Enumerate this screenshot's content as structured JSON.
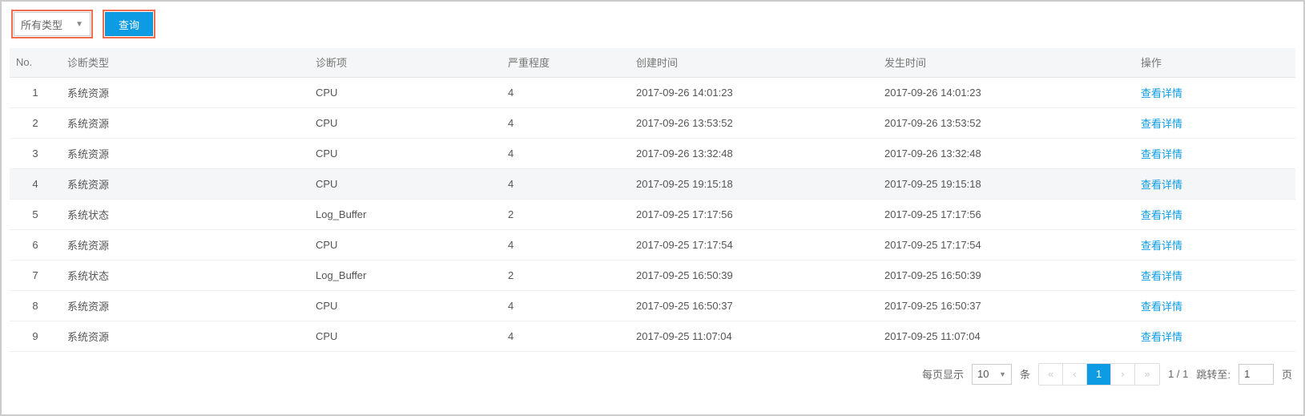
{
  "toolbar": {
    "filter_label": "所有类型",
    "query_label": "查询"
  },
  "table": {
    "headers": {
      "no": "No.",
      "type": "诊断类型",
      "item": "诊断项",
      "severity": "严重程度",
      "created": "创建时间",
      "occurred": "发生时间",
      "action": "操作"
    },
    "action_label": "查看详情",
    "rows": [
      {
        "no": "1",
        "type": "系统资源",
        "item": "CPU",
        "severity": "4",
        "created": "2017-09-26 14:01:23",
        "occurred": "2017-09-26 14:01:23",
        "highlight": false
      },
      {
        "no": "2",
        "type": "系统资源",
        "item": "CPU",
        "severity": "4",
        "created": "2017-09-26 13:53:52",
        "occurred": "2017-09-26 13:53:52",
        "highlight": false
      },
      {
        "no": "3",
        "type": "系统资源",
        "item": "CPU",
        "severity": "4",
        "created": "2017-09-26 13:32:48",
        "occurred": "2017-09-26 13:32:48",
        "highlight": false
      },
      {
        "no": "4",
        "type": "系统资源",
        "item": "CPU",
        "severity": "4",
        "created": "2017-09-25 19:15:18",
        "occurred": "2017-09-25 19:15:18",
        "highlight": true
      },
      {
        "no": "5",
        "type": "系统状态",
        "item": "Log_Buffer",
        "severity": "2",
        "created": "2017-09-25 17:17:56",
        "occurred": "2017-09-25 17:17:56",
        "highlight": false
      },
      {
        "no": "6",
        "type": "系统资源",
        "item": "CPU",
        "severity": "4",
        "created": "2017-09-25 17:17:54",
        "occurred": "2017-09-25 17:17:54",
        "highlight": false
      },
      {
        "no": "7",
        "type": "系统状态",
        "item": "Log_Buffer",
        "severity": "2",
        "created": "2017-09-25 16:50:39",
        "occurred": "2017-09-25 16:50:39",
        "highlight": false
      },
      {
        "no": "8",
        "type": "系统资源",
        "item": "CPU",
        "severity": "4",
        "created": "2017-09-25 16:50:37",
        "occurred": "2017-09-25 16:50:37",
        "highlight": false
      },
      {
        "no": "9",
        "type": "系统资源",
        "item": "CPU",
        "severity": "4",
        "created": "2017-09-25 11:07:04",
        "occurred": "2017-09-25 11:07:04",
        "highlight": false
      }
    ]
  },
  "pager": {
    "per_page_label": "每页显示",
    "page_size": "10",
    "unit_label": "条",
    "current_page": "1",
    "total_text": "1 / 1",
    "jump_label": "跳转至:",
    "jump_value": "1",
    "jump_suffix": "页"
  }
}
